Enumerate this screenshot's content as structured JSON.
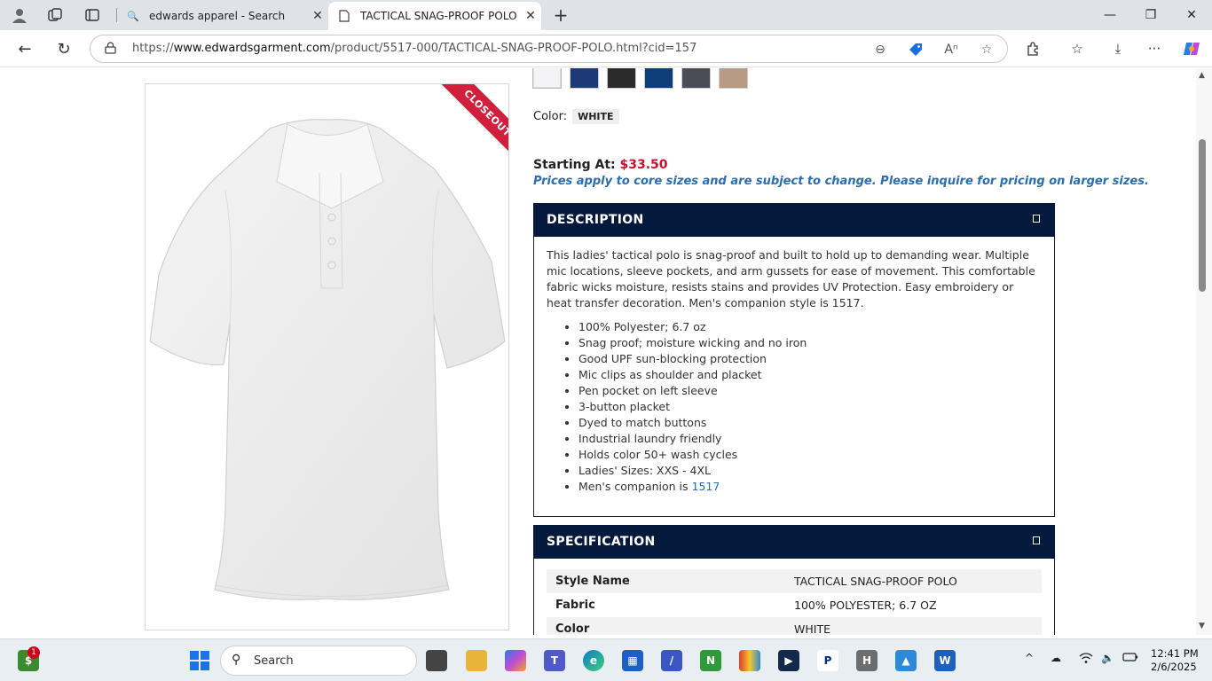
{
  "browser": {
    "tabs": [
      {
        "title": "edwards apparel - Search",
        "active": false
      },
      {
        "title": "TACTICAL SNAG-PROOF POLO | E",
        "active": true
      }
    ],
    "url_prefix": "https://",
    "url_domain": "www.edwardsgarment.com",
    "url_path": "/product/5517-000/TACTICAL-SNAG-PROOF-POLO.html?cid=157"
  },
  "product": {
    "ribbon": "CLOSEOUT",
    "swatch_colors": [
      "#f4f4f6",
      "#1c3a78",
      "#2b2b2b",
      "#0c3e7a",
      "#4a4d55",
      "#b99b85"
    ],
    "color_label": "Color:",
    "color_value": "WHITE",
    "price_label": "Starting At:",
    "price": "$33.50",
    "price_note": "Prices apply to core sizes and are subject to change. Please inquire for pricing on larger sizes."
  },
  "description": {
    "heading": "DESCRIPTION",
    "text": "This ladies' tactical polo is snag-proof and built to hold up to demanding wear. Multiple mic locations, sleeve pockets, and arm gussets for ease of movement. This comfortable fabric wicks moisture, resists stains and provides UV Protection. Easy embroidery or heat transfer decoration. Men's companion style is 1517.",
    "bullets": [
      "100% Polyester; 6.7 oz",
      "Snag proof; moisture wicking and no iron",
      "Good UPF sun-blocking protection",
      "Mic clips as shoulder and placket",
      "Pen pocket on left sleeve",
      "3-button placket",
      "Dyed to match buttons",
      "Industrial laundry friendly",
      "Holds color 50+ wash cycles",
      "Ladies' Sizes: XXS - 4XL"
    ],
    "companion_prefix": "Men's companion is",
    "companion_link": "1517"
  },
  "specification": {
    "heading": "SPECIFICATION",
    "rows": [
      {
        "key": "Style Name",
        "value": "TACTICAL SNAG-PROOF POLO"
      },
      {
        "key": "Fabric",
        "value": "100% POLYESTER; 6.7 OZ"
      },
      {
        "key": "Color",
        "value": "WHITE"
      }
    ]
  },
  "taskbar": {
    "search_placeholder": "Search",
    "badge_count": "1",
    "time": "12:41 PM",
    "date": "2/6/2025"
  }
}
